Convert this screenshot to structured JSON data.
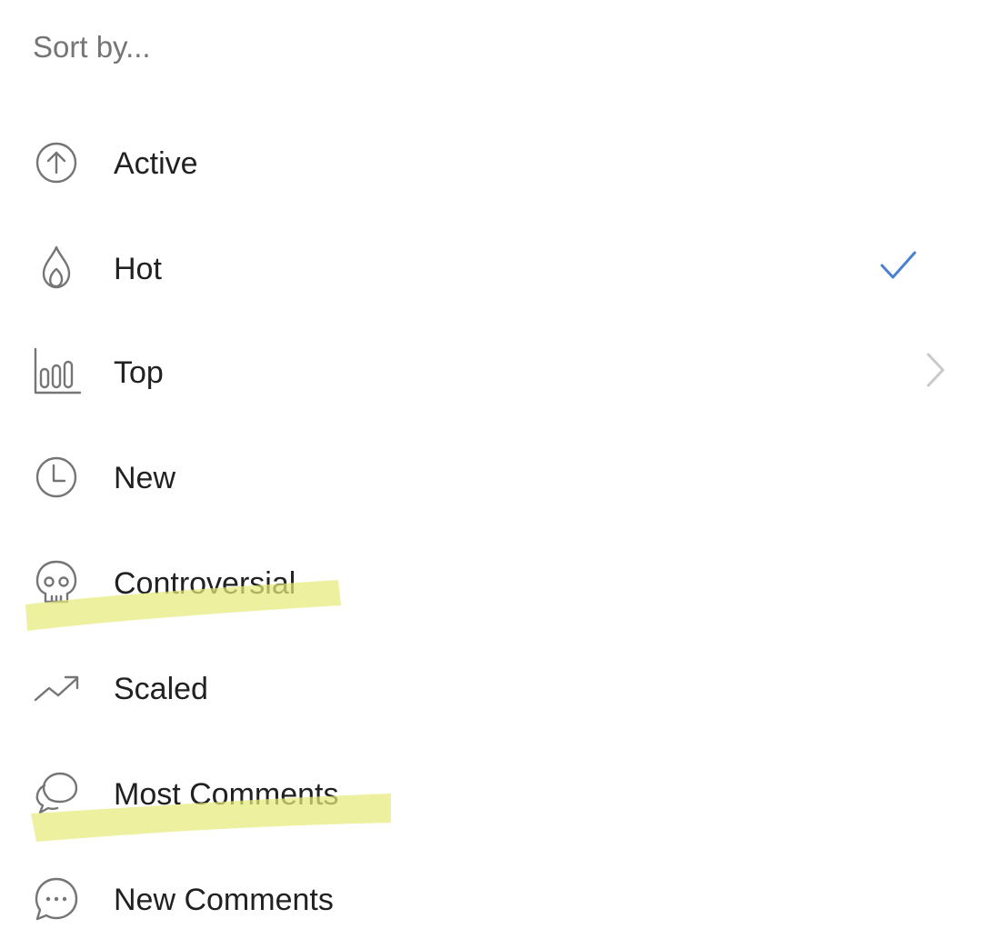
{
  "sheet": {
    "title": "Sort by...",
    "selected_color": "#4A7FD4",
    "highlight_color": "#E6EC7A",
    "items": [
      {
        "label": "Active",
        "icon": "arrow-up-circle-icon"
      },
      {
        "label": "Hot",
        "icon": "flame-icon",
        "selected": true
      },
      {
        "label": "Top",
        "icon": "bar-chart-icon",
        "has_submenu": true
      },
      {
        "label": "New",
        "icon": "clock-icon"
      },
      {
        "label": "Controversial",
        "icon": "skull-icon",
        "highlighted": true
      },
      {
        "label": "Scaled",
        "icon": "trending-up-icon"
      },
      {
        "label": "Most Comments",
        "icon": "chat-bubbles-icon",
        "highlighted": true
      },
      {
        "label": "New Comments",
        "icon": "chat-dots-icon"
      }
    ]
  }
}
